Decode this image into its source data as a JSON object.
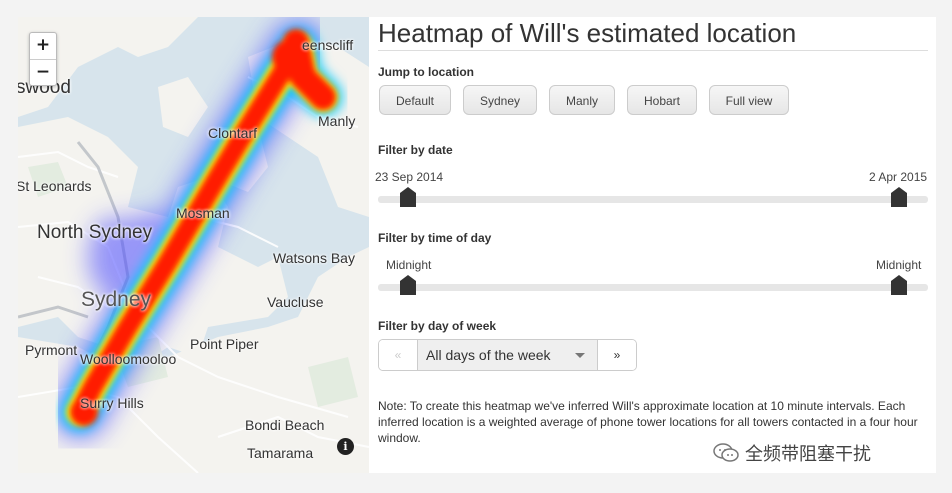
{
  "map": {
    "zoom_in": "+",
    "zoom_out": "−",
    "info": "i",
    "labels": {
      "swood": "swood",
      "queenscliff": "eenscliff",
      "manly": "Manly",
      "clontarf": "Clontarf",
      "st_leonards": "St Leonards",
      "mosman": "Mosman",
      "north_sydney": "North Sydney",
      "watsons_bay": "Watsons Bay",
      "sydney": "Sydney",
      "vaucluse": "Vaucluse",
      "pyrmont": "Pyrmont",
      "woolloomooloo": "Woolloomooloo",
      "point_piper": "Point Piper",
      "surry_hills": "Surry Hills",
      "bondi_beach": "Bondi Beach",
      "tamarama": "Tamarama"
    }
  },
  "panel": {
    "title": "Heatmap of Will's estimated location",
    "jump": {
      "heading": "Jump to location",
      "buttons": [
        "Default",
        "Sydney",
        "Manly",
        "Hobart",
        "Full view"
      ]
    },
    "date": {
      "heading": "Filter by date",
      "from": "23 Sep 2014",
      "to": "2 Apr 2015",
      "from_fraction": 0.0,
      "to_fraction": 1.0
    },
    "time": {
      "heading": "Filter by time of day",
      "from": "Midnight",
      "to": "Midnight",
      "from_fraction": 0.0,
      "to_fraction": 1.0
    },
    "week": {
      "heading": "Filter by day of week",
      "prev": "«",
      "selected": "All days of the week",
      "next": "»"
    },
    "note": "Note: To create this heatmap we've inferred Will's approximate location at 10 minute intervals. Each inferred location is a weighted average of phone tower locations for all towers contacted in a four hour window."
  },
  "watermark": {
    "text": "全频带阻塞干扰",
    "icon": "wechat-icon"
  },
  "colors": {
    "heat_core": "#ff1a00",
    "heat_mid": "#ffff00",
    "heat_outer": "#00c8ff",
    "heat_fringe": "#3a3aff"
  }
}
